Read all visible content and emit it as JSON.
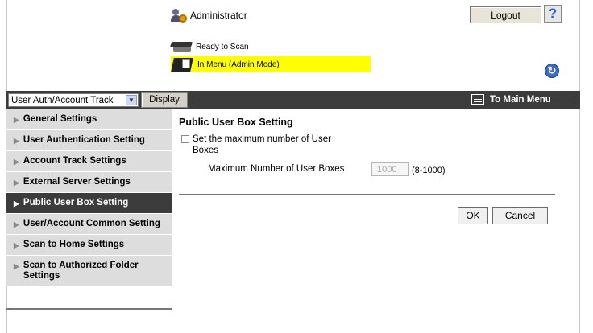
{
  "header": {
    "user_label": "Administrator",
    "logout_label": "Logout",
    "help_label": "?"
  },
  "status": {
    "ready_text": "Ready to Scan",
    "menu_text": "In Menu (Admin Mode)",
    "highlight_color": "#ffff00"
  },
  "toolbar": {
    "select_value": "User Auth/Account Track",
    "display_label": "Display",
    "to_main_label": "To Main Menu"
  },
  "sidebar": {
    "items": [
      {
        "label": "General Settings"
      },
      {
        "label": "User Authentication Setting"
      },
      {
        "label": "Account Track Settings"
      },
      {
        "label": "External Server Settings"
      },
      {
        "label": "Public User Box Setting",
        "active": true
      },
      {
        "label": "User/Account Common Setting"
      },
      {
        "label": "Scan to Home Settings"
      },
      {
        "label": "Scan to Authorized Folder Settings"
      }
    ]
  },
  "main": {
    "title": "Public User Box Setting",
    "checkbox_label": "Set the maximum number of User Boxes",
    "checkbox_checked": false,
    "field_label": "Maximum Number of User Boxes",
    "field_value": "1000",
    "field_range": "(8-1000)",
    "ok_label": "OK",
    "cancel_label": "Cancel"
  },
  "colors": {
    "dark_bar": "#3c3c3c",
    "sidebar_bg": "#dddddd"
  }
}
